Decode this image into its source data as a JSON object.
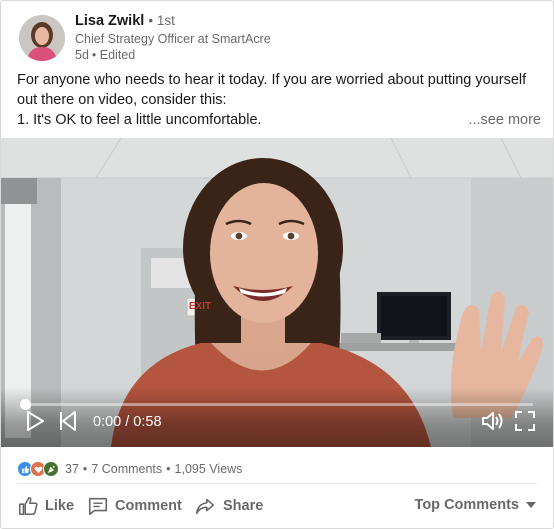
{
  "author": {
    "name": "Lisa Zwikl",
    "degree": "• 1st",
    "title": "Chief Strategy Officer at SmartAcre",
    "time": "5d",
    "edited": "• Edited"
  },
  "post": {
    "lines": [
      "For anyone who needs to hear it today. If you are worried about putting yourself",
      "out there on video, consider this:",
      "1. It's OK to feel a little uncomfortable."
    ],
    "see_more": "...see more"
  },
  "video": {
    "exit_sign": "EXIT",
    "time_display": "0:00 / 0:58",
    "progress_fraction": 0.0
  },
  "social": {
    "reaction_icons": [
      "like-icon",
      "love-icon",
      "celebrate-icon"
    ],
    "reaction_colors": [
      "#378fe9",
      "#df704d",
      "#44712e"
    ],
    "reaction_count": "37",
    "comments": "7 Comments",
    "views": "1,095 Views",
    "separator": "•"
  },
  "actions": {
    "like": "Like",
    "comment": "Comment",
    "share": "Share",
    "sort": "Top Comments"
  }
}
